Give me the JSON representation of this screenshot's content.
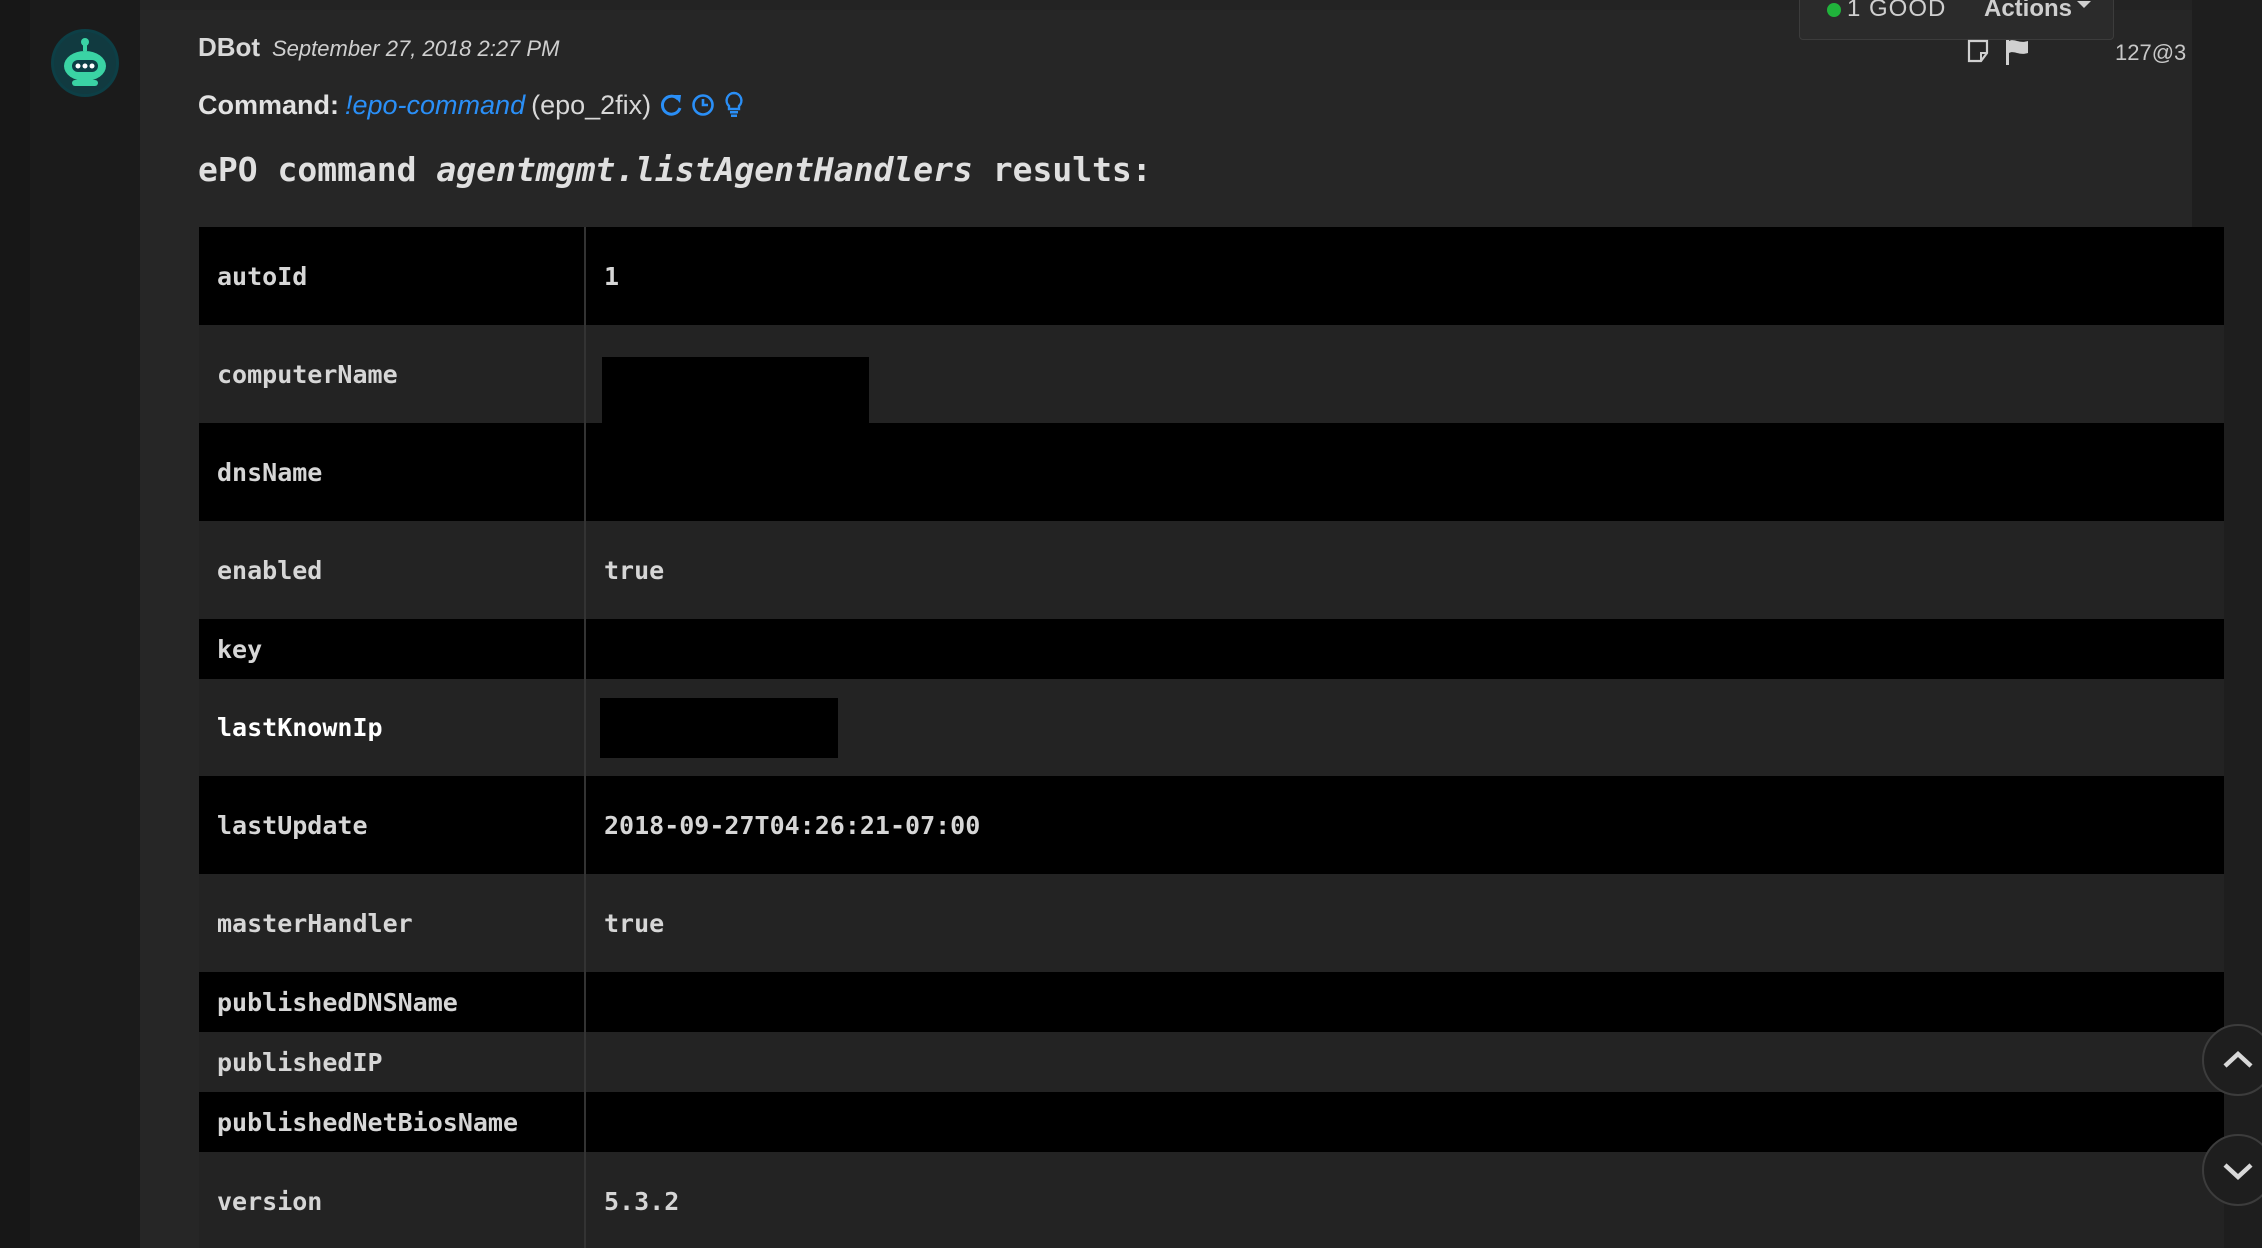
{
  "header": {
    "author": "DBot",
    "timestamp": "September 27, 2018 2:27 PM",
    "entry_id": "127@3",
    "status_label": "1 GOOD",
    "actions_label": "Actions"
  },
  "command": {
    "label": "Command:",
    "name": "!epo-command",
    "instance": "(epo_2fix)"
  },
  "result_title": {
    "prefix": "ePO command ",
    "command": "agentmgmt.listAgentHandlers",
    "suffix": " results:"
  },
  "table": {
    "rows": [
      {
        "key": "autoId",
        "value": "1"
      },
      {
        "key": "computerName",
        "value": "",
        "redacted": true
      },
      {
        "key": "dnsName",
        "value": ""
      },
      {
        "key": "enabled",
        "value": "true"
      },
      {
        "key": "key",
        "value": ""
      },
      {
        "key": "lastKnownIp",
        "value": "",
        "redacted": true
      },
      {
        "key": "lastUpdate",
        "value": "2018-09-27T04:26:21-07:00"
      },
      {
        "key": "masterHandler",
        "value": "true"
      },
      {
        "key": "publishedDNSName",
        "value": ""
      },
      {
        "key": "publishedIP",
        "value": ""
      },
      {
        "key": "publishedNetBiosName",
        "value": ""
      },
      {
        "key": "version",
        "value": "5.3.2"
      }
    ]
  },
  "icons": {
    "avatar": "robot-icon",
    "note": "note-icon",
    "flag": "flag-icon",
    "rerun": "refresh-icon",
    "history": "clock-icon",
    "hint": "lightbulb-icon",
    "scroll_up": "chevron-up-icon",
    "scroll_down": "chevron-down-icon"
  },
  "colors": {
    "accent": "#2a8ff7",
    "good": "#20b33b",
    "avatar": "#3ad3a4"
  }
}
